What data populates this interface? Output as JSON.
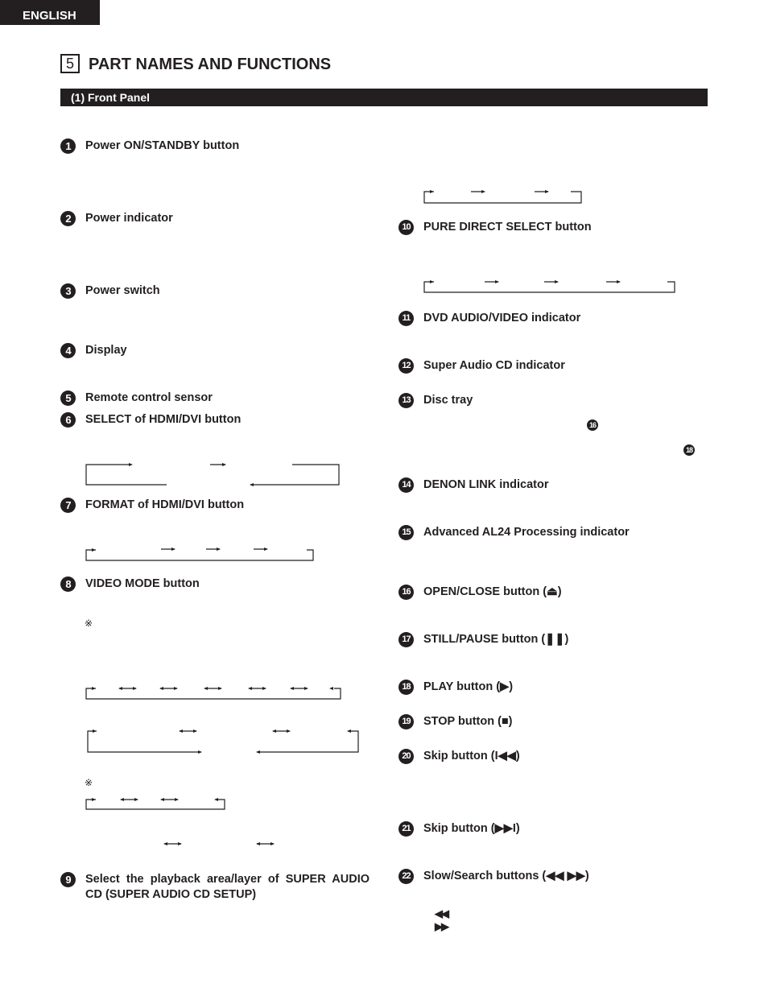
{
  "header": {
    "language_tab": "ENGLISH",
    "section_number": "5",
    "section_title": "PART NAMES AND FUNCTIONS",
    "subsection_title": "(1) Front Panel"
  },
  "items": [
    {
      "num": "1",
      "label": "Power ON/STANDBY button"
    },
    {
      "num": "2",
      "label": "Power indicator"
    },
    {
      "num": "3",
      "label": "Power switch"
    },
    {
      "num": "4",
      "label": "Display"
    },
    {
      "num": "5",
      "label": "Remote control sensor"
    },
    {
      "num": "6",
      "label": "SELECT of HDMI/DVI button"
    },
    {
      "num": "7",
      "label": "FORMAT of HDMI/DVI button"
    },
    {
      "num": "8",
      "label": "VIDEO MODE button"
    },
    {
      "num": "9",
      "label": "Select the playback area/layer of SUPER AUDIO CD (SUPER AUDIO CD SETUP)"
    },
    {
      "num": "10",
      "label": "PURE DIRECT SELECT button"
    },
    {
      "num": "11",
      "label": "DVD AUDIO/VIDEO indicator"
    },
    {
      "num": "12",
      "label": "Super Audio CD indicator"
    },
    {
      "num": "13",
      "label": "Disc tray"
    },
    {
      "num": "14",
      "label": "DENON LINK indicator"
    },
    {
      "num": "15",
      "label": "Advanced AL24 Processing indicator"
    },
    {
      "num": "16",
      "label": "OPEN/CLOSE button (⏏)"
    },
    {
      "num": "17",
      "label": "STILL/PAUSE button (❚❚)"
    },
    {
      "num": "18",
      "label": "PLAY button (▶)"
    },
    {
      "num": "19",
      "label": "STOP button (■)"
    },
    {
      "num": "20",
      "label": "Skip button (I◀◀)"
    },
    {
      "num": "21",
      "label": "Skip button (▶▶I)"
    },
    {
      "num": "22",
      "label": "Slow/Search buttons (◀◀  ▶▶)"
    }
  ],
  "references": {
    "disc_tray_ref_a": "16",
    "disc_tray_ref_b": "18"
  },
  "notes": {
    "note_mark": "※"
  },
  "symbols": {
    "rewind": "◀◀",
    "fast_forward": "▶▶"
  }
}
